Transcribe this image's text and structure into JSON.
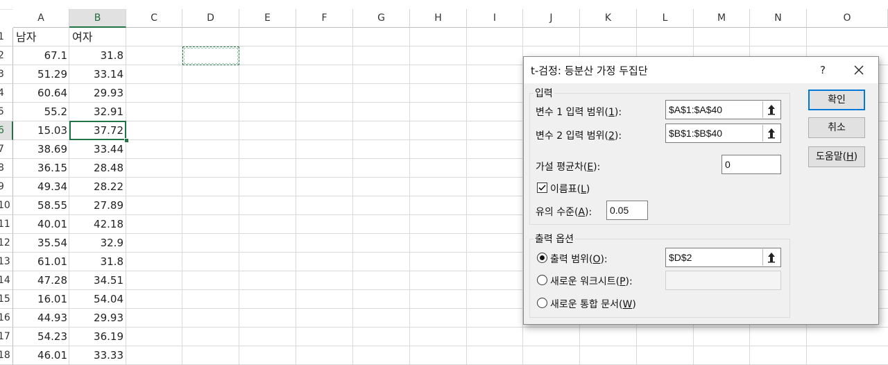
{
  "sheet": {
    "columns": [
      "A",
      "B",
      "C",
      "D",
      "E",
      "F",
      "G",
      "H",
      "I",
      "J",
      "K",
      "L",
      "M",
      "N",
      "O"
    ],
    "selected_column": "B",
    "row_numbers": [
      "1",
      "2",
      "3",
      "4",
      "5",
      "6",
      "7",
      "8",
      "9",
      "10",
      "11",
      "12",
      "13",
      "14",
      "15",
      "16",
      "17",
      "18"
    ],
    "selected_row": "6",
    "headers": {
      "a1": "남자",
      "b1": "여자"
    },
    "rows": [
      {
        "a": "67.1",
        "b": "31.8"
      },
      {
        "a": "51.29",
        "b": "33.14"
      },
      {
        "a": "60.64",
        "b": "29.93"
      },
      {
        "a": "55.2",
        "b": "32.91"
      },
      {
        "a": "15.03",
        "b": "37.72"
      },
      {
        "a": "38.69",
        "b": "33.44"
      },
      {
        "a": "36.15",
        "b": "28.48"
      },
      {
        "a": "49.34",
        "b": "28.22"
      },
      {
        "a": "58.55",
        "b": "27.89"
      },
      {
        "a": "40.01",
        "b": "42.18"
      },
      {
        "a": "35.54",
        "b": "32.9"
      },
      {
        "a": "61.01",
        "b": "31.8"
      },
      {
        "a": "47.28",
        "b": "34.51"
      },
      {
        "a": "16.01",
        "b": "54.04"
      },
      {
        "a": "44.93",
        "b": "29.93"
      },
      {
        "a": "54.23",
        "b": "36.19"
      },
      {
        "a": "46.01",
        "b": "33.33"
      }
    ],
    "accent_color": "#217346"
  },
  "dialog": {
    "title": "t-검정: 등분산 가정 두집단",
    "help": "?",
    "input_group": "입력",
    "var1_label": "변수 1 입력 범위(",
    "var1_key": "1",
    "var1_value": "$A$1:$A$40",
    "var2_label": "변수 2 입력 범위(",
    "var2_key": "2",
    "var2_value": "$B$1:$B$40",
    "hyp_label": "가설 평균차(",
    "hyp_key": "E",
    "hyp_value": "0",
    "labels_label": "이름표(",
    "labels_key": "L",
    "labels_checked": true,
    "alpha_label": "유의 수준(",
    "alpha_key": "A",
    "alpha_value": "0.05",
    "output_group": "출력 옵션",
    "out_range_label": "출력 범위(",
    "out_range_key": "O",
    "out_range_value": "$D$2",
    "new_sheet_label": "새로운 워크시트(",
    "new_sheet_key": "P",
    "new_book_label": "새로운 통합 문서(",
    "new_book_key": "W",
    "ok": "확인",
    "cancel": "취소",
    "help_btn_label": "도움말(",
    "help_btn_key": "H",
    "close_paren": "):",
    "close_paren_btn": ")",
    "primary_color": "#0078d7"
  }
}
